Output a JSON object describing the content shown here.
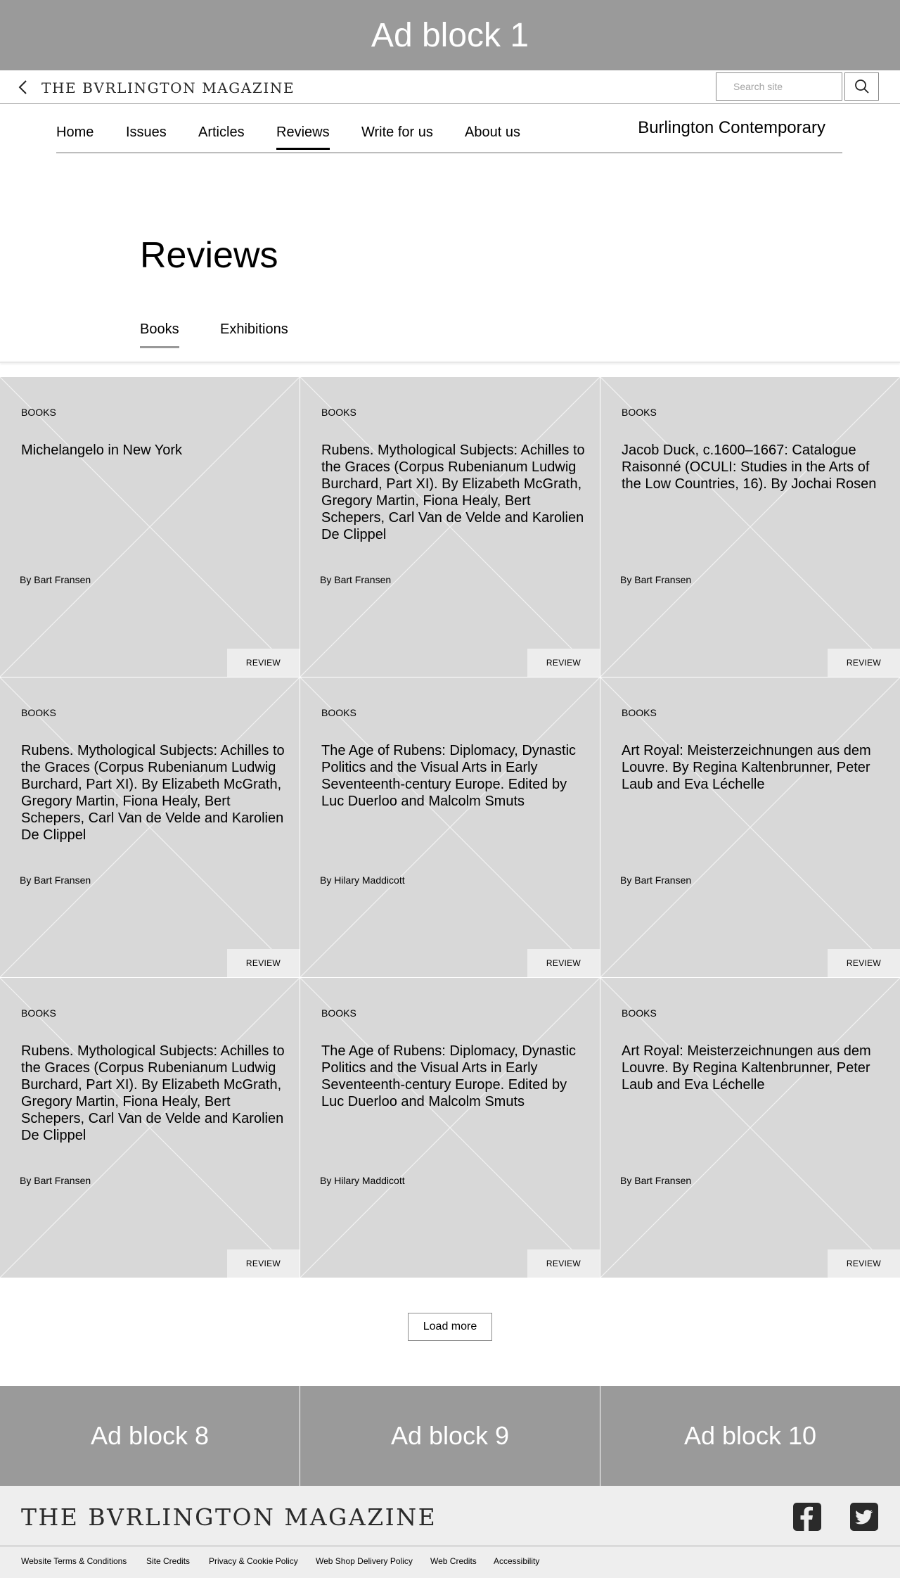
{
  "ads": {
    "top": "Ad block 1",
    "bottom": [
      "Ad block 8",
      "Ad block 9",
      "Ad block 10"
    ]
  },
  "header": {
    "logo": "THE BVRLINGTON MAGAZINE",
    "search_placeholder": "Search site"
  },
  "nav": {
    "items": [
      "Home",
      "Issues",
      "Articles",
      "Reviews",
      "Write for us",
      "About us"
    ],
    "active": "Reviews",
    "contemporary": "Burlington Contemporary"
  },
  "page": {
    "title": "Reviews",
    "tabs": [
      "Books",
      "Exhibitions"
    ],
    "active_tab": "Books"
  },
  "cards": [
    {
      "category": "BOOKS",
      "title": "Michelangelo in New York",
      "byline": "By Bart Fransen",
      "badge": "REVIEW"
    },
    {
      "category": "BOOKS",
      "title": "Rubens. Mythological Subjects: Achilles to the Graces (Corpus Rubenianum Ludwig Burchard, Part XI). By Elizabeth McGrath, Gregory Martin, Fiona Healy, Bert Schepers, Carl Van de Velde and Karolien De Clippel",
      "byline": "By Bart Fransen",
      "badge": "REVIEW"
    },
    {
      "category": "BOOKS",
      "title": "Jacob Duck, c.1600–1667: Catalogue Raisonné (OCULI: Studies in the Arts of the Low Countries, 16). By Jochai Rosen",
      "byline": "By Bart Fransen",
      "badge": "REVIEW"
    },
    {
      "category": "BOOKS",
      "title": "Rubens. Mythological Subjects: Achilles to the Graces (Corpus Rubenianum Ludwig Burchard, Part XI). By Elizabeth McGrath, Gregory Martin, Fiona Healy, Bert Schepers, Carl Van de Velde and Karolien De Clippel",
      "byline": "By Bart Fransen",
      "badge": "REVIEW"
    },
    {
      "category": "BOOKS",
      "title": "The Age of Rubens: Diplomacy, Dynastic Politics and the Visual Arts in Early Seventeenth-century Europe. Edited by Luc Duerloo and Malcolm Smuts",
      "byline": "By Hilary Maddicott",
      "badge": "REVIEW"
    },
    {
      "category": "BOOKS",
      "title": "Art Royal: Meisterzeichnungen aus dem Louvre. By Regina Kaltenbrunner, Peter Laub and Eva Léchelle",
      "byline": "By Bart Fransen",
      "badge": "REVIEW"
    },
    {
      "category": "BOOKS",
      "title": "Rubens. Mythological Subjects: Achilles to the Graces (Corpus Rubenianum Ludwig Burchard, Part XI). By Elizabeth McGrath, Gregory Martin, Fiona Healy, Bert Schepers, Carl Van de Velde and Karolien De Clippel",
      "byline": "By Bart Fransen",
      "badge": "REVIEW"
    },
    {
      "category": "BOOKS",
      "title": "The Age of Rubens: Diplomacy, Dynastic Politics and the Visual Arts in Early Seventeenth-century Europe. Edited by Luc Duerloo and Malcolm Smuts",
      "byline": "By Hilary Maddicott",
      "badge": "REVIEW"
    },
    {
      "category": "BOOKS",
      "title": "Art Royal: Meisterzeichnungen aus dem Louvre. By Regina Kaltenbrunner, Peter Laub and Eva Léchelle",
      "byline": "By Bart Fransen",
      "badge": "REVIEW"
    }
  ],
  "load_more": "Load more",
  "footer": {
    "logo": "THE BVRLINGTON MAGAZINE",
    "social": [
      "facebook-icon",
      "twitter-icon"
    ],
    "links": [
      "Website Terms & Conditions",
      "Site Credits",
      "Privacy & Cookie Policy",
      "Web Shop Delivery Policy",
      "Web Credits",
      "Accessibility"
    ]
  },
  "colors": {
    "ad_background": "#9a9a9a",
    "card_background": "#d8d8d8",
    "footer_background": "#eeeeee"
  }
}
